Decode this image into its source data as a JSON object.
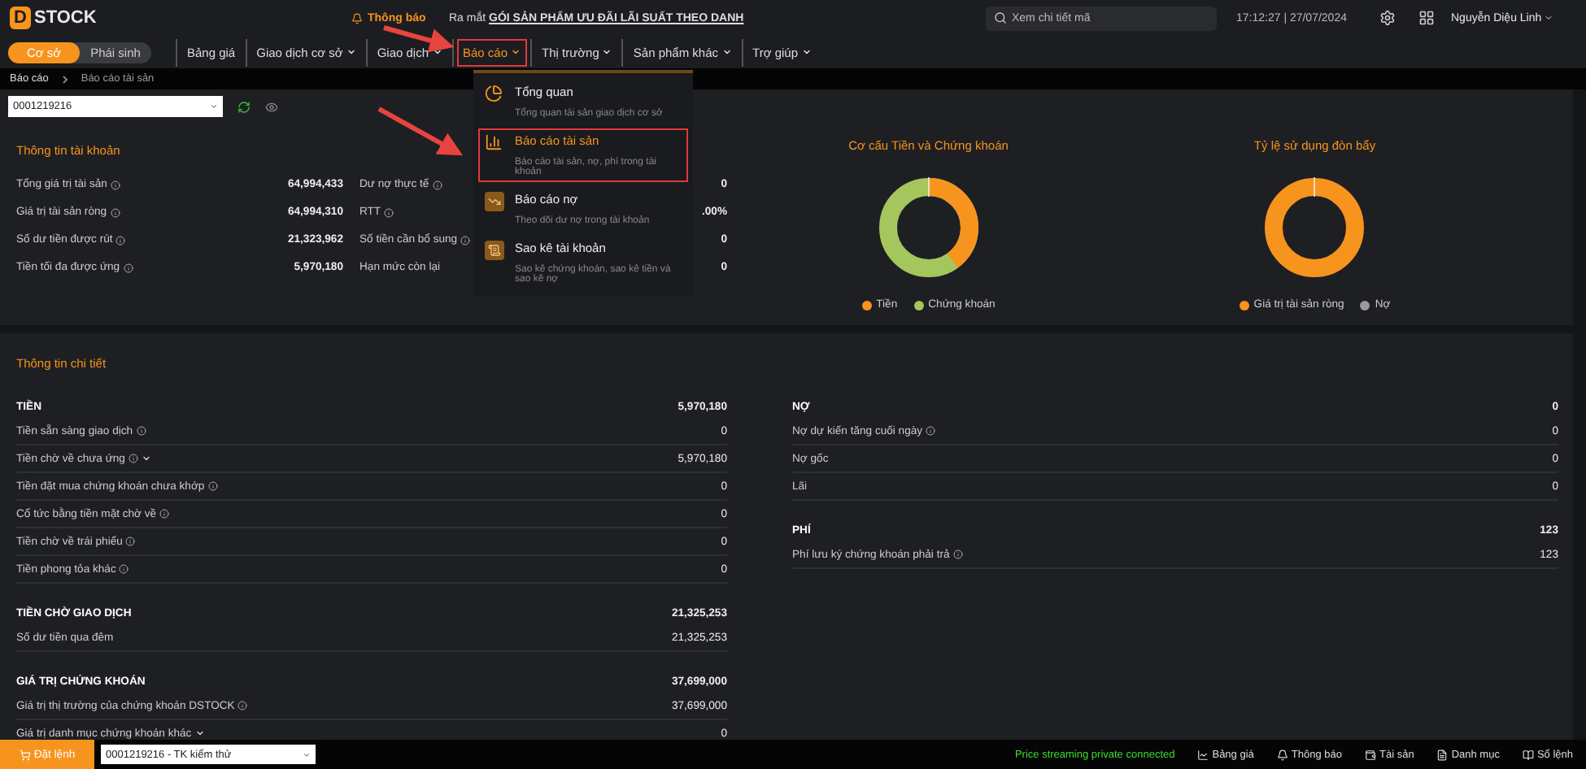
{
  "header": {
    "logo": "STOCK",
    "logo_mark": "D",
    "notice_label": "Thông báo",
    "announcement_prefix": "Ra mắt",
    "announcement_link": "GÓI SẢN PHẨM ƯU ĐÃI LÃI SUẤT THEO DANH",
    "search": {
      "placeholder": "Xem chi tiết mã"
    },
    "clock": "17:12:27 | 27/07/2024",
    "user": "Nguyễn Diệu Linh"
  },
  "market_toggle": [
    {
      "label": "Cơ sở",
      "selected": true
    },
    {
      "label": "Phái sinh",
      "selected": false
    }
  ],
  "nav": [
    {
      "label": "Bảng giá",
      "dropdown": false,
      "selected": false,
      "highlighted": false
    },
    {
      "label": "Giao dịch cơ sở",
      "dropdown": true,
      "selected": false,
      "highlighted": false
    },
    {
      "label": "Giao dịch",
      "dropdown": true,
      "selected": false,
      "highlighted": false
    },
    {
      "label": "Báo cáo",
      "dropdown": true,
      "selected": true,
      "highlighted": true
    },
    {
      "label": "Thị trường",
      "dropdown": true,
      "selected": false,
      "highlighted": false
    },
    {
      "label": "Sản phẩm khác",
      "dropdown": true,
      "selected": false,
      "highlighted": false
    },
    {
      "label": "Trợ giúp",
      "dropdown": true,
      "selected": false,
      "highlighted": false
    }
  ],
  "menu": [
    {
      "kind": "pie",
      "title": "Tổng quan",
      "description": "Tổng quan tài sản giao dịch cơ sở",
      "selected": false,
      "highlighted": false
    },
    {
      "kind": "bars",
      "title": "Báo cáo tài sản",
      "description": "Báo cáo tài sản, nợ, phí trong tài khoản",
      "selected": true,
      "highlighted": true
    },
    {
      "kind": "debt",
      "title": "Báo cáo nợ",
      "description": "Theo dõi dư nợ trong tài khoản",
      "selected": false,
      "highlighted": false
    },
    {
      "kind": "statement",
      "title": "Sao kê tài khoản",
      "description": "Sao kê chứng khoán, sao kê tiền và sao kê nợ",
      "selected": false,
      "highlighted": false
    }
  ],
  "breadcrumb": [
    "Báo cáo",
    "Báo cáo tài sản"
  ],
  "account_select": "0001219216",
  "account_info": {
    "title": "Thông tin tài khoản",
    "left": [
      {
        "label": "Tổng giá trị tài sản",
        "info": true,
        "value": "64,994,433"
      },
      {
        "label": "Giá trị tài sản ròng",
        "info": true,
        "value": "64,994,310"
      },
      {
        "label": "Số dư tiền được rút",
        "info": true,
        "value": "21,323,962"
      },
      {
        "label": "Tiền tối đa được ứng",
        "info": true,
        "value": "5,970,180"
      }
    ],
    "right": [
      {
        "label": "Dư nợ thực tế",
        "info": true,
        "value": "0"
      },
      {
        "label": "RTT",
        "info": true,
        "value": ".00%"
      },
      {
        "label": "Số tiền cần bổ sung",
        "info": true,
        "value": "0"
      },
      {
        "label": "Hạn mức còn lại",
        "info": false,
        "value": "0"
      }
    ]
  },
  "charts": [
    {
      "title": "Cơ cấu Tiền và Chứng khoán",
      "legend": [
        {
          "label": "Tiền",
          "color": "#f7941d"
        },
        {
          "label": "Chứng khoán",
          "color": "#a4c65d"
        }
      ]
    },
    {
      "title": "Tỷ lệ sử dụng đòn bẩy",
      "legend": [
        {
          "label": "Giá trị tài sản ròng",
          "color": "#f7941d"
        },
        {
          "label": "Nợ",
          "color": "#9b9b9b"
        }
      ]
    }
  ],
  "detail": {
    "title": "Thông tin chi tiết",
    "left": [
      {
        "title": "TIỀN",
        "value": "5,970,180",
        "rows": [
          {
            "label": "Tiền sẵn sàng giao dịch",
            "info": true,
            "dropdown": false,
            "value": "0"
          },
          {
            "label": "Tiền chờ về chưa ứng",
            "info": true,
            "dropdown": true,
            "value": "5,970,180"
          },
          {
            "label": "Tiền đặt mua chứng khoán chưa khớp",
            "info": true,
            "dropdown": false,
            "value": "0"
          },
          {
            "label": "Cổ tức bằng tiền mặt chờ về",
            "info": true,
            "dropdown": false,
            "value": "0"
          },
          {
            "label": "Tiền chờ về trái phiếu",
            "info": true,
            "dropdown": false,
            "value": "0"
          },
          {
            "label": "Tiền phong tỏa khác",
            "info": true,
            "dropdown": false,
            "value": "0"
          }
        ]
      },
      {
        "title": "TIỀN CHỜ GIAO DỊCH",
        "value": "21,325,253",
        "rows": [
          {
            "label": "Số dư tiền qua đêm",
            "info": false,
            "dropdown": false,
            "value": "21,325,253"
          }
        ]
      },
      {
        "title": "GIÁ TRỊ CHỨNG KHOÁN",
        "value": "37,699,000",
        "rows": [
          {
            "label": "Giá trị thị trường của chứng khoán DSTOCK",
            "info": true,
            "dropdown": false,
            "value": "37,699,000"
          },
          {
            "label": "Giá trị danh mục chứng khoán khác",
            "info": false,
            "dropdown": true,
            "value": "0"
          }
        ]
      }
    ],
    "right": [
      {
        "title": "NỢ",
        "value": "0",
        "rows": [
          {
            "label": "Nợ dự kiến tăng cuối ngày",
            "info": true,
            "dropdown": false,
            "value": "0"
          },
          {
            "label": "Nợ gốc",
            "info": false,
            "dropdown": false,
            "value": "0"
          },
          {
            "label": "Lãi",
            "info": false,
            "dropdown": false,
            "value": "0"
          }
        ]
      },
      {
        "title": "PHÍ",
        "value": "123",
        "rows": [
          {
            "label": "Phí lưu ký chứng khoán phải trả",
            "info": true,
            "dropdown": false,
            "value": "123"
          }
        ]
      }
    ]
  },
  "footer": {
    "order_button": "Đặt lệnh",
    "account": "0001219216 - TK kiểm thử",
    "status": "Price streaming private connected",
    "links": [
      {
        "kind": "chart",
        "label": "Bảng giá"
      },
      {
        "kind": "bell",
        "label": "Thông báo"
      },
      {
        "kind": "asset",
        "label": "Tài sản"
      },
      {
        "kind": "list",
        "label": "Danh mục"
      },
      {
        "kind": "book",
        "label": "Sổ lệnh"
      }
    ]
  }
}
